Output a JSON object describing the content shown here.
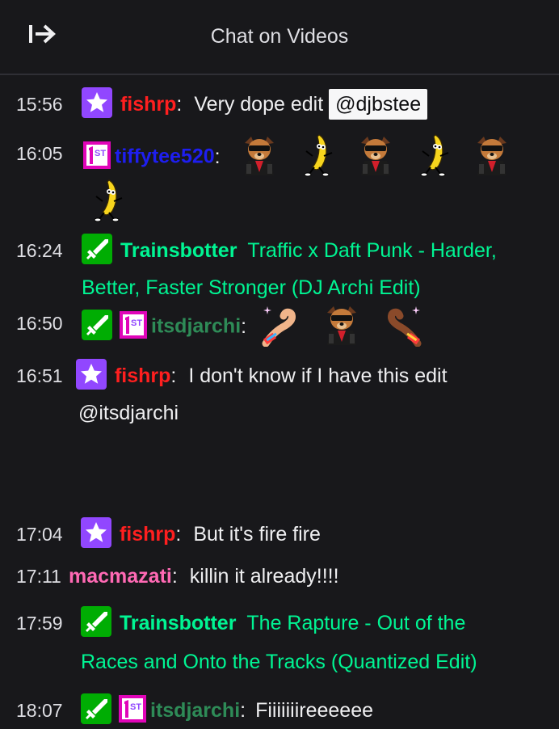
{
  "header": {
    "title": "Chat on Videos"
  },
  "colors": {
    "fishrp": "#ff1f1f",
    "tiffytee520": "#1e1ef0",
    "trainsbotter": "#00f593",
    "itsdjarchi": "#2e8b57",
    "macmazati": "#ff69b4"
  },
  "messages": [
    {
      "time": "15:56",
      "user": "fishrp",
      "text": "Very dope edit",
      "mention": "@djbstee"
    },
    {
      "time": "16:05",
      "user": "tiffytee520",
      "emotes": [
        "dog-sunglasses-emote",
        "banana-dance-emote",
        "dog-sunglasses-emote",
        "banana-dance-emote",
        "dog-sunglasses-emote",
        "banana-dance-emote"
      ]
    },
    {
      "time": "16:24",
      "user": "Trainsbotter",
      "text_line1": "Traffic x Daft Punk - Harder,",
      "text_line2": "Better, Faster Stronger (DJ Archi Edit)"
    },
    {
      "time": "16:50",
      "user": "itsdjarchi",
      "emotes": [
        "heart-hand-left-emote",
        "dog-sunglasses-emote",
        "heart-hand-right-emote"
      ]
    },
    {
      "time": "16:51",
      "user": "fishrp",
      "text_line1": "I don't know if I have this edit",
      "text_line2": "@itsdjarchi"
    },
    {
      "time": "17:04",
      "user": "fishrp",
      "text": "But it's fire fire"
    },
    {
      "time": "17:11",
      "user": "macmazati",
      "text": "killin it already!!!!"
    },
    {
      "time": "17:59",
      "user": "Trainsbotter",
      "text_line1": "The Rapture - Out of the",
      "text_line2": "Races and Onto the Tracks (Quantized Edit)"
    },
    {
      "time": "18:07",
      "user": "itsdjarchi",
      "text": "Fiiiiiiireeeeee"
    }
  ]
}
